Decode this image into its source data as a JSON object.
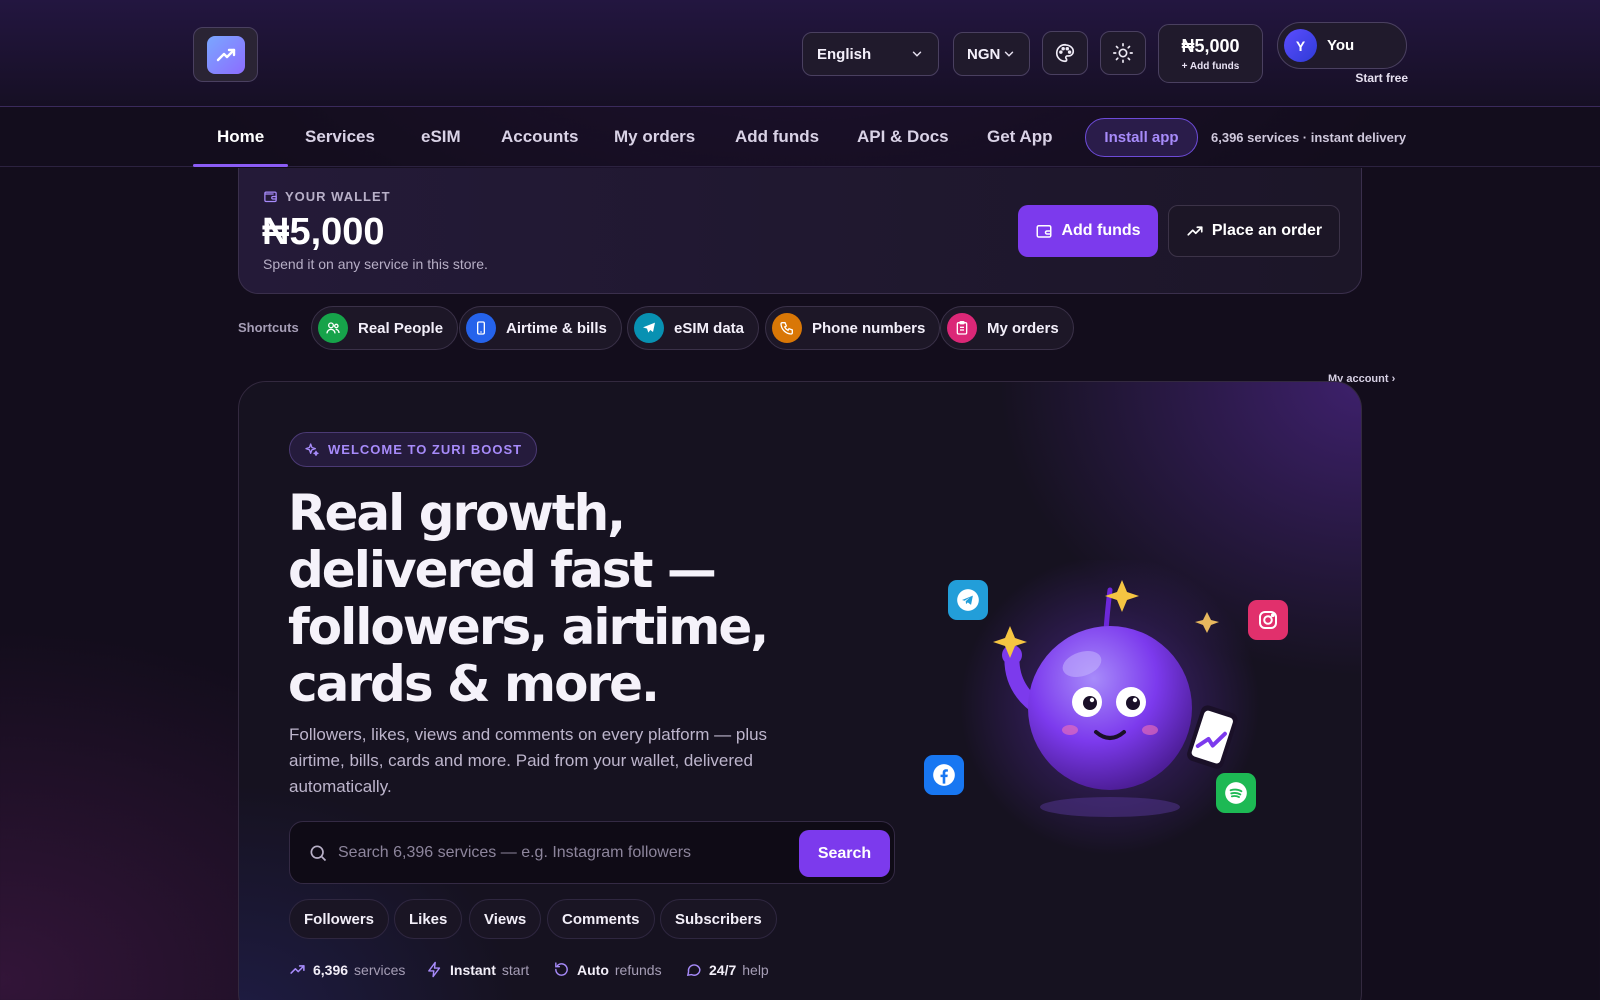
{
  "header": {
    "language": "English",
    "currency": "NGN",
    "balance": "₦5,000",
    "add_funds": "+ Add funds",
    "account_name": "You",
    "account_link": "My account ›",
    "avatar_initial": "Y",
    "start_free": "Start free"
  },
  "nav": {
    "items": [
      "Home",
      "Services",
      "eSIM",
      "Accounts",
      "My orders",
      "Add funds",
      "API & Docs",
      "Get App"
    ],
    "active": "Home",
    "install_app": "Install app",
    "meta": "6,396 services · instant delivery"
  },
  "wallet": {
    "label": "YOUR WALLET",
    "amount": "₦5,000",
    "note": "Spend it on any service in this store.",
    "add_funds": "Add funds",
    "place_order": "Place an order"
  },
  "shortcuts": {
    "label": "Shortcuts",
    "items": [
      {
        "label": "Real People",
        "icon": "users-icon",
        "color": "#16a34a"
      },
      {
        "label": "Airtime & bills",
        "icon": "phone-device-icon",
        "color": "#2563eb"
      },
      {
        "label": "eSIM data",
        "icon": "plane-icon",
        "color": "#0891b2"
      },
      {
        "label": "Phone numbers",
        "icon": "phone-call-icon",
        "color": "#d97706"
      },
      {
        "label": "My orders",
        "icon": "clipboard-icon",
        "color": "#db2777"
      }
    ]
  },
  "hero": {
    "badge": "WELCOME TO ZURI BOOST",
    "headline_lines": [
      "Real growth,",
      "delivered fast —",
      "followers, airtime,",
      "cards & more."
    ],
    "subtext": "Followers, likes, views and comments on every platform — plus airtime, bills, cards and more. Paid from your wallet, delivered automatically.",
    "search_placeholder": "Search 6,396 services — e.g. Instagram followers",
    "search_button": "Search",
    "tags": [
      "Followers",
      "Likes",
      "Views",
      "Comments",
      "Subscribers"
    ],
    "stats": [
      {
        "bold": "6,396",
        "text": "services",
        "icon": "trend-icon"
      },
      {
        "bold": "Instant",
        "text": "start",
        "icon": "bolt-icon"
      },
      {
        "bold": "Auto",
        "text": "refunds",
        "icon": "refresh-icon"
      },
      {
        "bold": "24/7",
        "text": "help",
        "icon": "chat-icon"
      }
    ]
  },
  "colors": {
    "accent": "#7c3aed",
    "accent_light": "#a78bfa",
    "background": "#130d1c"
  }
}
